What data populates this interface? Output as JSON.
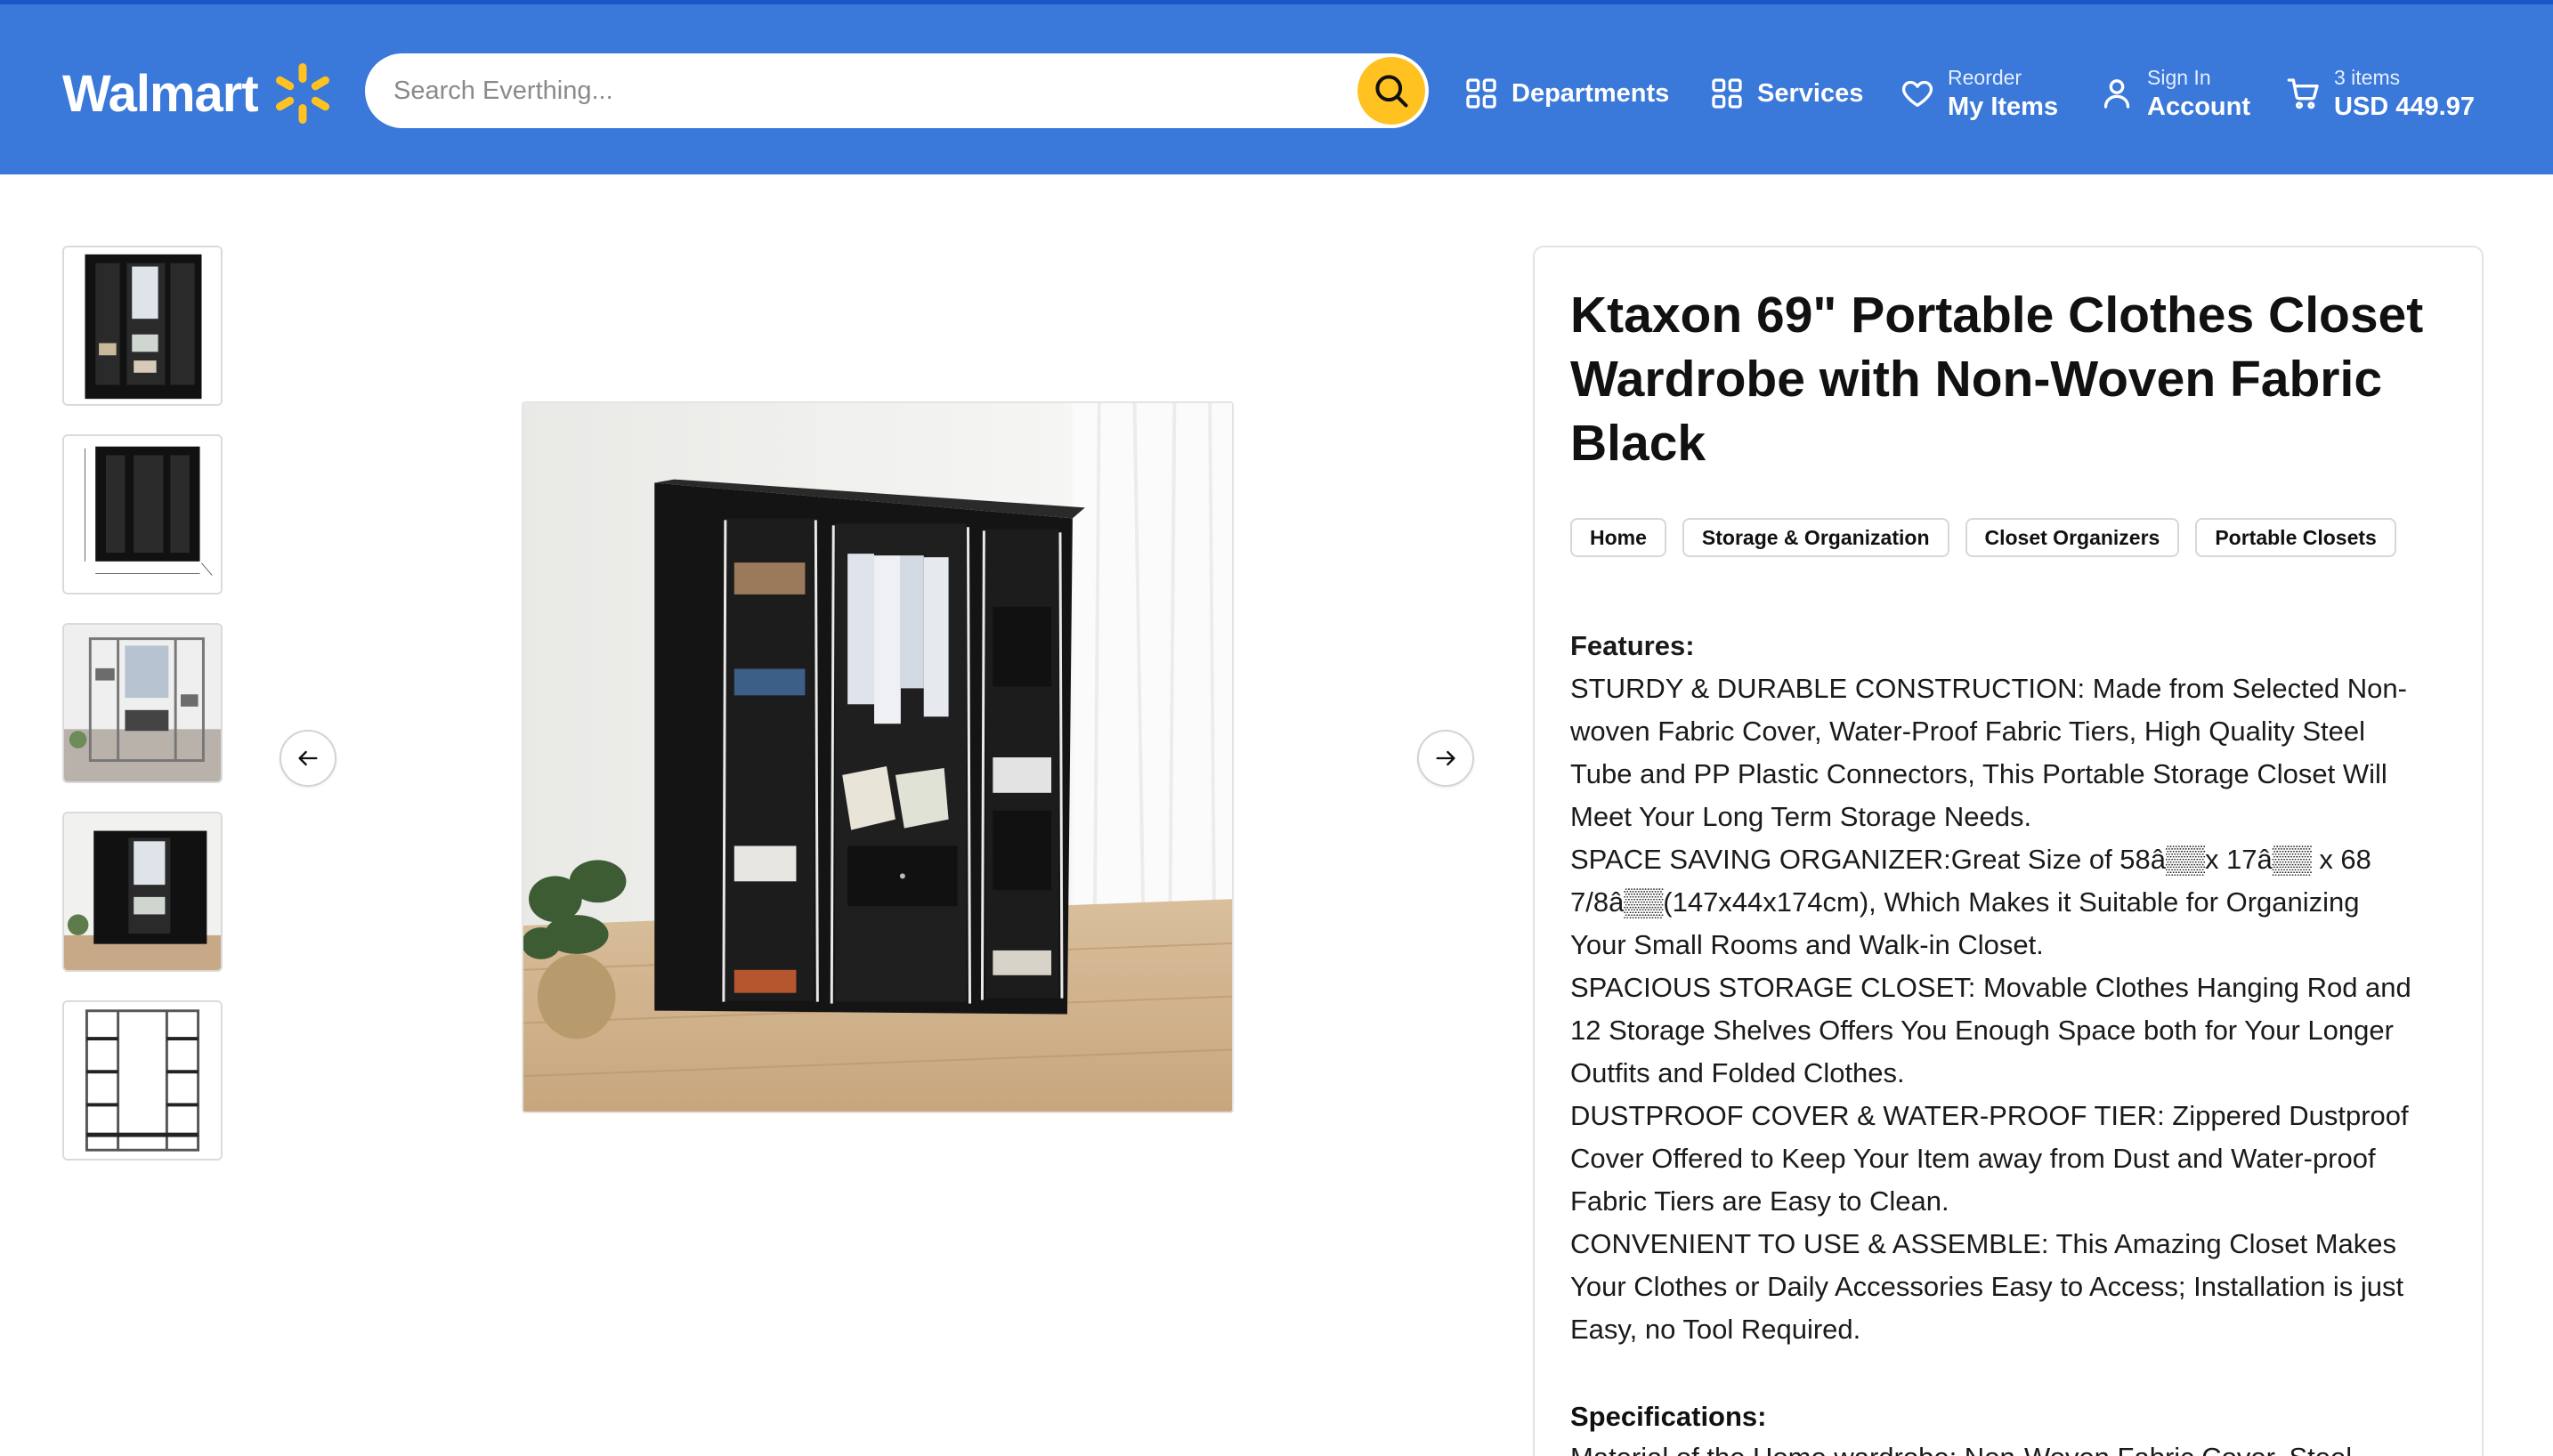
{
  "header": {
    "logo_text": "Walmart",
    "search_placeholder": "Search Everthing...",
    "nav": {
      "departments": "Departments",
      "services": "Services",
      "reorder_small": "Reorder",
      "reorder_big": "My Items",
      "signin_small": "Sign In",
      "signin_big": "Account",
      "cart_small": "3 items",
      "cart_big": "USD 449.97"
    }
  },
  "product": {
    "title": "Ktaxon 69\" Portable Clothes Closet Wardrobe with Non-Woven Fabric Black",
    "breadcrumbs": [
      "Home",
      "Storage & Organization",
      "Closet Organizers",
      "Portable Closets"
    ],
    "features_heading": "Features:",
    "features_lines": [
      "STURDY & DURABLE CONSTRUCTION: Made from Selected Non-",
      "woven Fabric Cover, Water-Proof Fabric Tiers, High Quality Steel",
      "Tube and PP Plastic Connectors, This Portable Storage Closet Will",
      "Meet Your Long Term Storage Needs.",
      "SPACE SAVING ORGANIZER:Great Size of  58â▒▒x 17â▒▒ x 68",
      "7/8â▒▒(147x44x174cm), Which Makes it Suitable for Organizing",
      "Your Small Rooms and Walk-in Closet.",
      "SPACIOUS STORAGE CLOSET: Movable Clothes Hanging Rod and",
      "12 Storage Shelves Offers You Enough Space both for Your Longer",
      "Outfits and Folded Clothes.",
      "DUSTPROOF COVER & WATER-PROOF TIER: Zippered Dustproof",
      "Cover Offered to Keep Your Item away from Dust and Water-proof",
      "Fabric Tiers are Easy to Clean.",
      "CONVENIENT TO USE & ASSEMBLE: This Amazing Closet Makes",
      "Your Clothes or Daily Accessories Easy to Access; Installation is just",
      "Easy, no Tool Required."
    ],
    "specifications_heading": "Specifications:",
    "specifications_partial": "Material of the Home wardrobe: Non-Woven Fabric Cover, Steel"
  },
  "gallery": {
    "thumbnails": [
      "closet-front-thumbnail",
      "closet-dimensions-thumbnail",
      "closet-frame-room-thumbnail",
      "closet-room-thumbnail",
      "closet-frame-thumbnail"
    ],
    "main_image": "black-portable-closet-photo",
    "prev_icon": "arrow-left-icon",
    "next_icon": "arrow-right-icon"
  },
  "colors": {
    "header_blue": "#3a78d9",
    "accent_yellow": "#ffc220"
  }
}
